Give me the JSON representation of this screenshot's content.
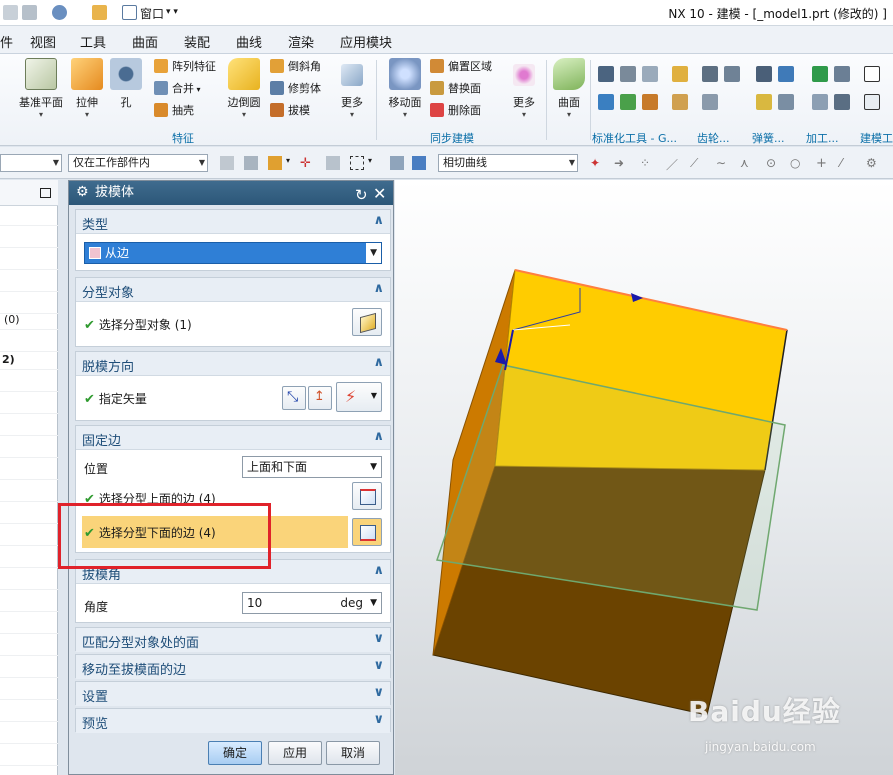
{
  "window": {
    "title": "NX 10 - 建模 - [_model1.prt  (修改的) ]",
    "window_menu_label": "窗口"
  },
  "menu": {
    "items": [
      "件",
      "视图",
      "工具",
      "曲面",
      "装配",
      "曲线",
      "渲染",
      "应用模块"
    ]
  },
  "ribbon": {
    "big_buttons": [
      "基准平面",
      "拉伸",
      "孔",
      "边倒圆",
      "更多",
      "移动面",
      "更多",
      "曲面"
    ],
    "feature_small": [
      "阵列特征",
      "合并",
      "抽壳",
      "倒斜角",
      "修剪体",
      "拔模"
    ],
    "sync_small": [
      "偏置区域",
      "替换面",
      "删除面"
    ],
    "groups": [
      "特征",
      "同步建模",
      "标准化工具 - G...",
      "齿轮...",
      "弹簧...",
      "加工...",
      "建模工"
    ]
  },
  "toolbar": {
    "scope_combo": "仅在工作部件内",
    "curve_rule_combo": "相切曲线"
  },
  "navigator": {
    "rows": [
      "",
      "",
      "",
      "",
      "",
      "",
      "(0)",
      "",
      "2)",
      "",
      "",
      "",
      "",
      "",
      "",
      "",
      "",
      "",
      "",
      "",
      "",
      "",
      "",
      "",
      "",
      "",
      "",
      "",
      ""
    ]
  },
  "dialog": {
    "title": "拔模体",
    "sections": {
      "type": {
        "title": "类型",
        "value": "从边"
      },
      "parting_object": {
        "title": "分型对象",
        "select_label": "选择分型对象 (1)"
      },
      "draw_direction": {
        "title": "脱模方向",
        "vector_label": "指定矢量"
      },
      "fixed_edges": {
        "title": "固定边",
        "location_label": "位置",
        "location_value": "上面和下面",
        "upper_label": "选择分型上面的边 (4)",
        "lower_label": "选择分型下面的边 (4)"
      },
      "draft_angle": {
        "title": "拔模角",
        "angle_label": "角度",
        "angle_value": "10",
        "angle_unit": "deg"
      },
      "collapsed": [
        "匹配分型对象处的面",
        "移动至拔模面的边",
        "设置",
        "预览"
      ]
    },
    "buttons": {
      "ok": "确定",
      "apply": "应用",
      "cancel": "取消"
    }
  },
  "watermark": {
    "main": "Baidu经验",
    "sub": "jingyan.baidu.com"
  },
  "colors": {
    "title_bar": "#2c5778",
    "highlight_row": "#fad47a",
    "annotation_box": "#e0222a",
    "model_top": "#ffcc00",
    "model_side": "#cc7a00",
    "model_bottom": "#6b4300",
    "check": "#2f9a2f"
  }
}
